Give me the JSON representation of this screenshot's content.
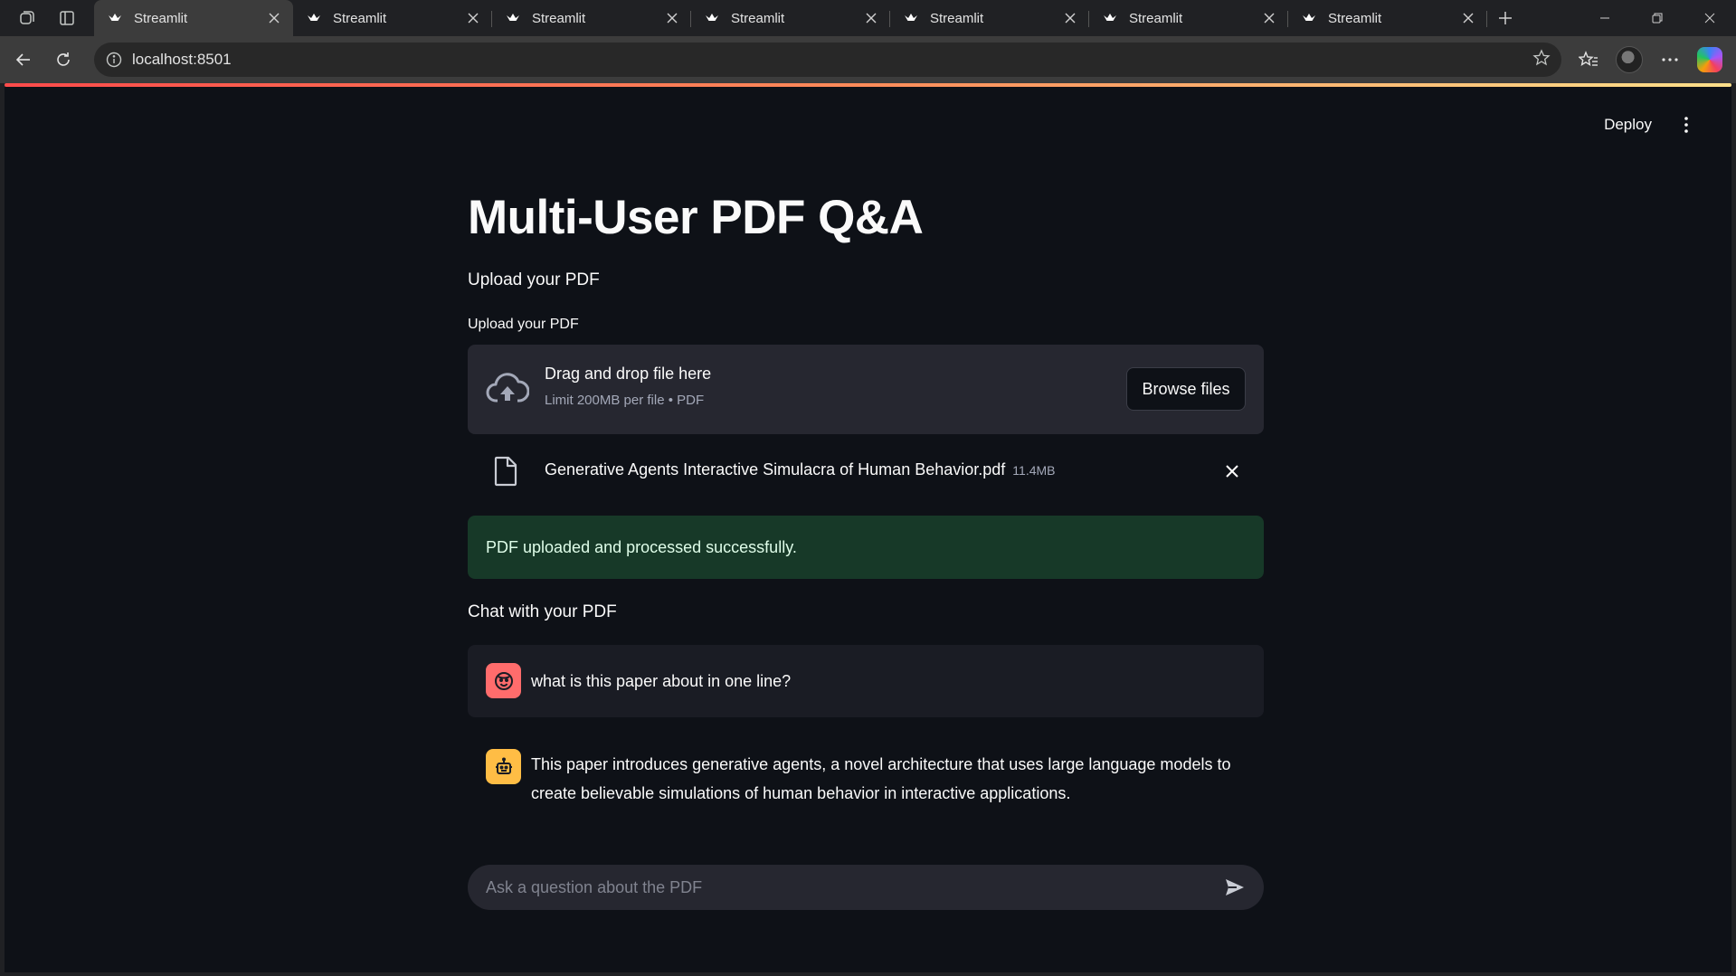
{
  "browser": {
    "tabs": [
      {
        "title": "Streamlit",
        "active": true
      },
      {
        "title": "Streamlit",
        "active": false
      },
      {
        "title": "Streamlit",
        "active": false
      },
      {
        "title": "Streamlit",
        "active": false
      },
      {
        "title": "Streamlit",
        "active": false
      },
      {
        "title": "Streamlit",
        "active": false
      },
      {
        "title": "Streamlit",
        "active": false
      }
    ],
    "url": "localhost:8501"
  },
  "app": {
    "header": {
      "deploy_label": "Deploy"
    },
    "title": "Multi-User PDF Q&A",
    "upload_subheader": "Upload your PDF",
    "uploader": {
      "label": "Upload your PDF",
      "drop_text": "Drag and drop file here",
      "limit_text": "Limit 200MB per file • PDF",
      "browse_label": "Browse files"
    },
    "uploaded_file": {
      "name": "Generative Agents Interactive Simulacra of Human Behavior.pdf",
      "size": "11.4MB"
    },
    "success_message": "PDF uploaded and processed successfully.",
    "chat_subheader": "Chat with your PDF",
    "messages": [
      {
        "role": "user",
        "text": "what is this paper about in one line?"
      },
      {
        "role": "assistant",
        "text": "This paper introduces generative agents, a novel architecture that uses large language models to create believable simulations of human behavior in interactive applications."
      }
    ],
    "chat_input": {
      "placeholder": "Ask a question about the PDF",
      "value": ""
    }
  },
  "colors": {
    "app_background": "#0e1117",
    "success_background": "#173928",
    "user_avatar": "#ff6c6c",
    "assistant_avatar": "#ffbd45"
  }
}
